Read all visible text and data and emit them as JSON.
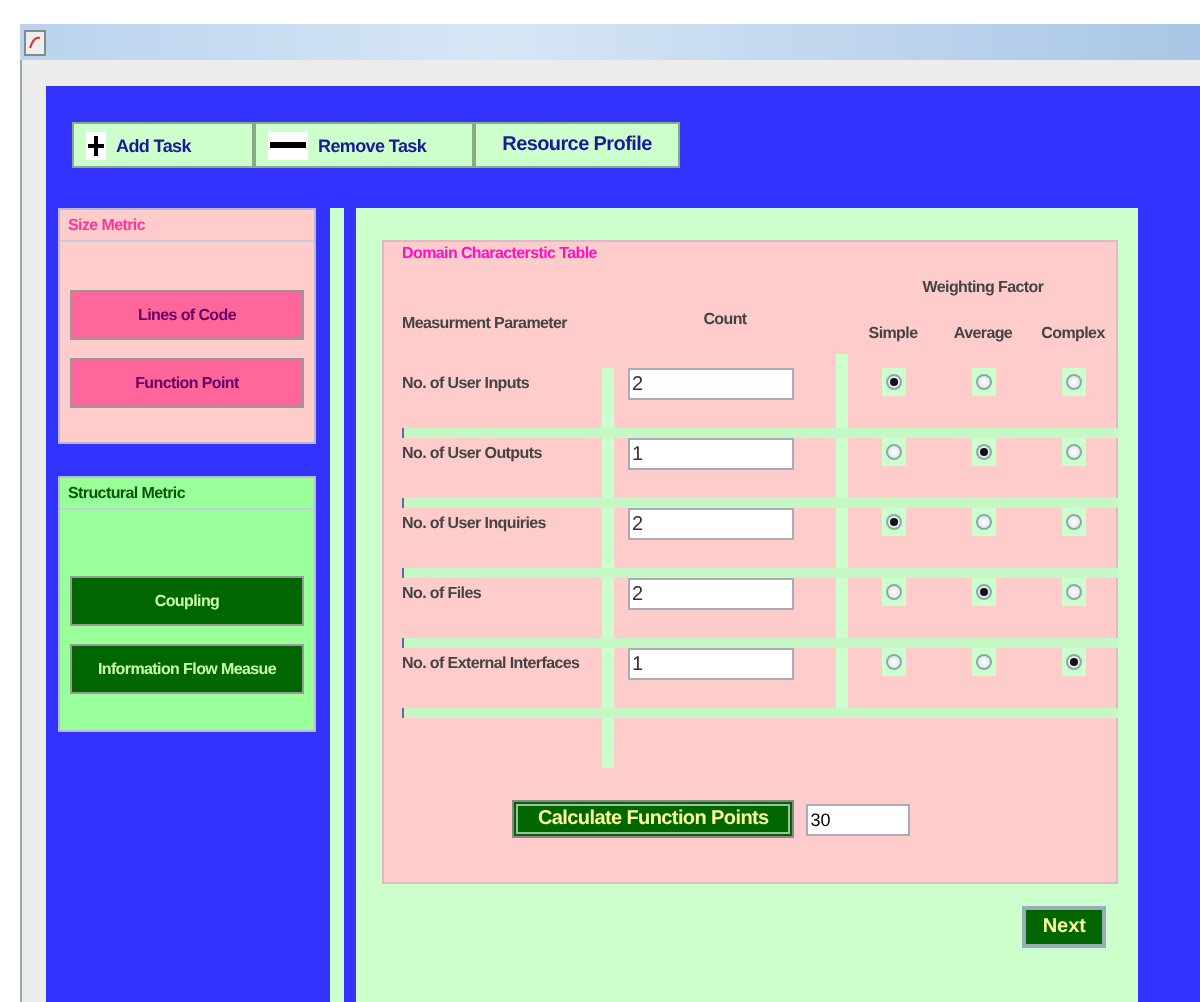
{
  "toolbar": [
    {
      "kind": "plus",
      "label": "Add Task"
    },
    {
      "kind": "minus",
      "label": "Remove Task"
    },
    {
      "kind": "plain",
      "label": "Resource Profile"
    }
  ],
  "size_metric": {
    "title": "Size Metric",
    "buttons": [
      "Lines of Code",
      "Function Point"
    ]
  },
  "structural_metric": {
    "title": "Structural Metric",
    "buttons": [
      "Coupling",
      "Information Flow Measue"
    ]
  },
  "table": {
    "title": "Domain Characterstic Table",
    "parameter_header": "Measurment Parameter",
    "count_header": "Count",
    "weighting_header": "Weighting Factor",
    "weight_columns": [
      "Simple",
      "Average",
      "Complex"
    ],
    "rows": [
      {
        "label": "No. of User Inputs",
        "count": "2",
        "weights": [
          {
            "selected": true
          },
          {
            "selected": false
          },
          {
            "selected": false
          }
        ]
      },
      {
        "label": "No. of User Outputs",
        "count": "1",
        "weights": [
          {
            "selected": false
          },
          {
            "selected": true
          },
          {
            "selected": false
          }
        ]
      },
      {
        "label": "No. of User Inquiries",
        "count": "2",
        "weights": [
          {
            "selected": true
          },
          {
            "selected": false
          },
          {
            "selected": false
          }
        ]
      },
      {
        "label": "No. of Files",
        "count": "2",
        "weights": [
          {
            "selected": false
          },
          {
            "selected": true
          },
          {
            "selected": false
          }
        ]
      },
      {
        "label": "No. of External Interfaces",
        "count": "1",
        "weights": [
          {
            "selected": false
          },
          {
            "selected": false
          },
          {
            "selected": true
          }
        ]
      }
    ]
  },
  "calculate": {
    "button": "Calculate Function Points",
    "result": "30"
  },
  "next_button": "Next"
}
